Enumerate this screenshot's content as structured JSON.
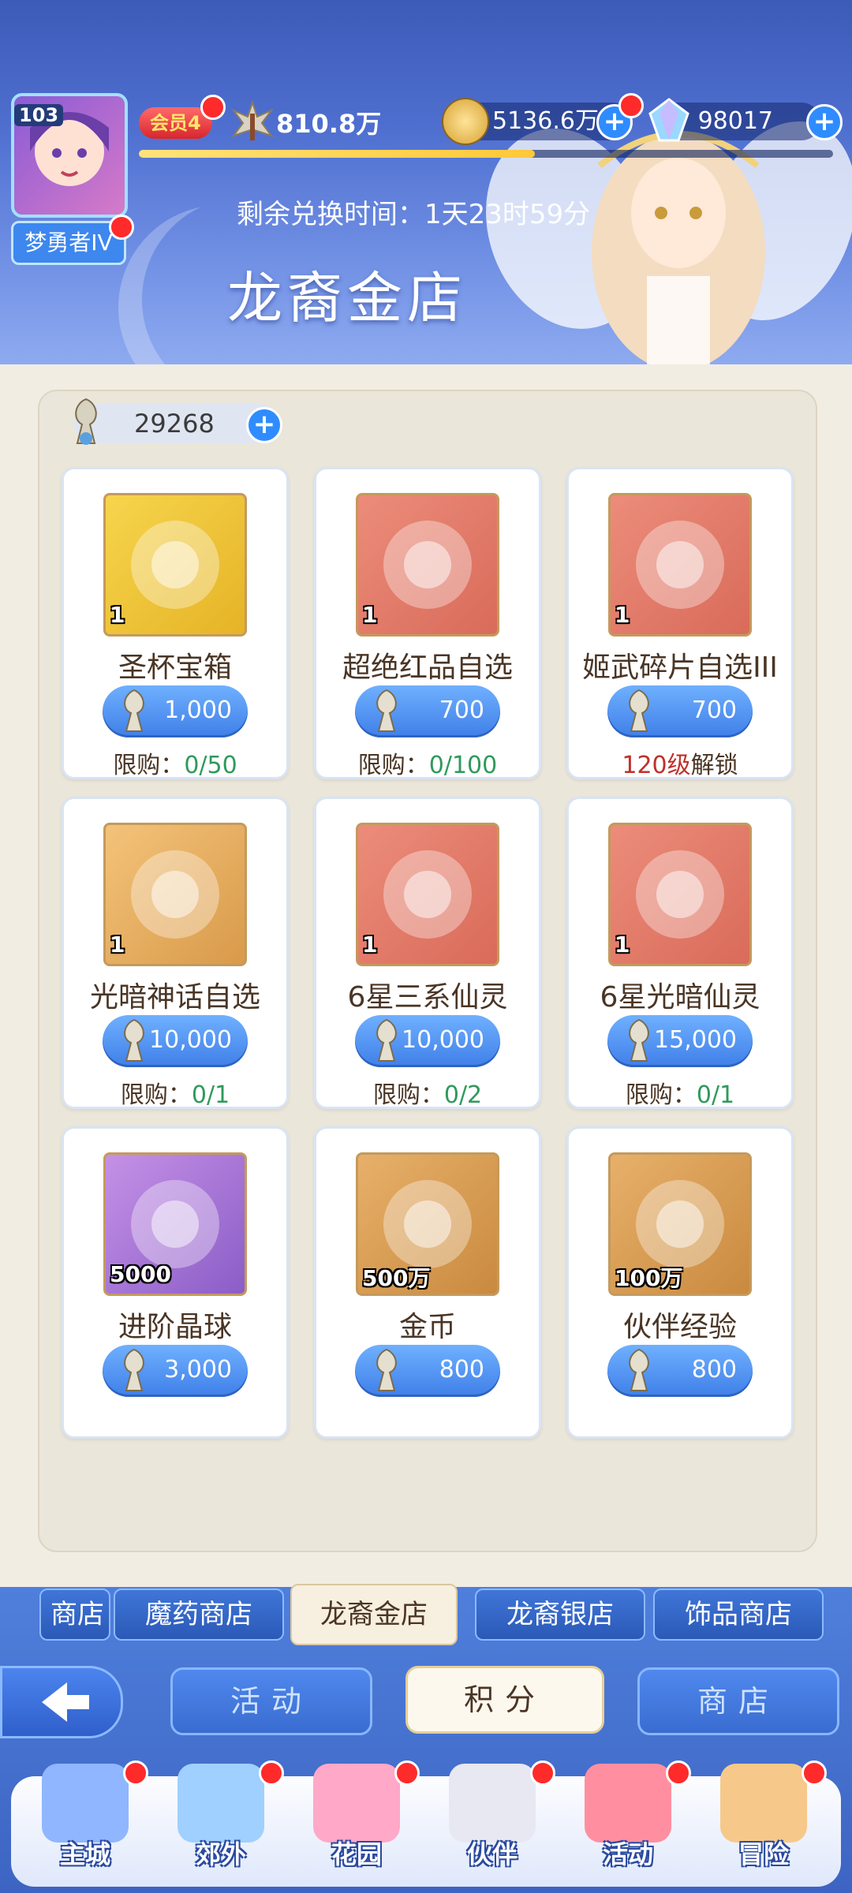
{
  "header": {
    "player_level": "103",
    "rank_label": "梦勇者IV",
    "vip_label": "会员4",
    "power_value": "810.8万",
    "gold_value": "5136.6万",
    "gem_value": "98017",
    "exp_progress": 0.57,
    "remaining_time_label": "剩余兑换时间：1天23时59分",
    "shop_title": "龙裔金店"
  },
  "currency": {
    "value": "29268",
    "icon": "dragon-coin-icon"
  },
  "items": [
    {
      "name": "圣杯宝箱",
      "qty": "1",
      "price": "1,000",
      "limit_label": "限购：",
      "limit_value": "0/50",
      "color": "yellow"
    },
    {
      "name": "超绝红品自选",
      "qty": "1",
      "price": "700",
      "limit_label": "限购：",
      "limit_value": "0/100",
      "color": "red"
    },
    {
      "name": "姬武碎片自选III",
      "qty": "1",
      "price": "700",
      "limit_label": "解锁",
      "limit_value": "120级",
      "color": "red"
    },
    {
      "name": "光暗神话自选",
      "qty": "1",
      "price": "10,000",
      "limit_label": "限购：",
      "limit_value": "0/1",
      "color": "orange"
    },
    {
      "name": "6星三系仙灵",
      "qty": "1",
      "price": "10,000",
      "limit_label": "限购：",
      "limit_value": "0/2",
      "color": "red"
    },
    {
      "name": "6星光暗仙灵",
      "qty": "1",
      "price": "15,000",
      "limit_label": "限购：",
      "limit_value": "0/1",
      "color": "red"
    },
    {
      "name": "进阶晶球",
      "qty": "5000",
      "price": "3,000",
      "limit_label": "",
      "limit_value": "",
      "color": "purple"
    },
    {
      "name": "金币",
      "qty": "500万",
      "price": "800",
      "limit_label": "",
      "limit_value": "",
      "color": "brown"
    },
    {
      "name": "伙伴经验",
      "qty": "100万",
      "price": "800",
      "limit_label": "",
      "limit_value": "",
      "color": "brown"
    }
  ],
  "shop_tabs": [
    "商店",
    "魔药商店",
    "龙裔金店",
    "龙裔银店",
    "饰品商店"
  ],
  "mid_buttons": [
    "活动",
    "积分",
    "商店"
  ],
  "nav": [
    "主城",
    "郊外",
    "花园",
    "伙伴",
    "活动",
    "冒险"
  ],
  "colors": {
    "accent": "#3f7fe8",
    "limit_green": "#2f9a5b",
    "limit_red": "#c0302b",
    "badge_red": "#ff2a2a"
  }
}
